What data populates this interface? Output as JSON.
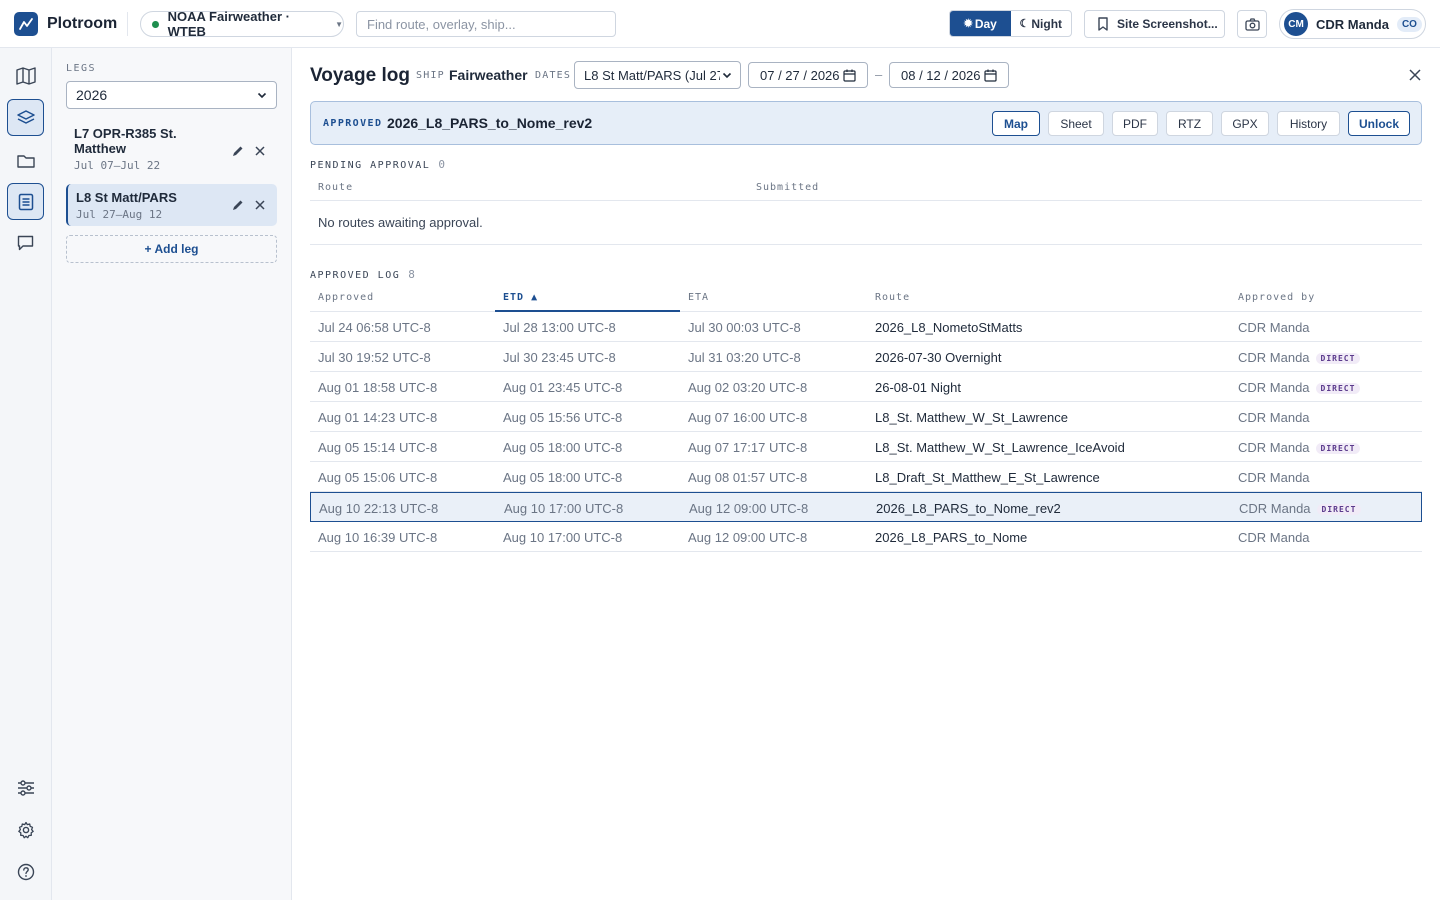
{
  "app": {
    "name": "Plotroom"
  },
  "topbar": {
    "ship_selector": "NOAA Fairweather · WTEB",
    "search_placeholder": "Find route, overlay, ship...",
    "day_label": "Day",
    "night_label": "Night",
    "mode_active": "Day",
    "site_screenshot_label": "Site Screenshot...",
    "user": {
      "initials": "CM",
      "name": "CDR Manda",
      "role": "CO"
    }
  },
  "rail": {
    "icons": [
      "map-icon",
      "layers-icon",
      "folder-icon",
      "document-icon",
      "chat-icon",
      "sliders-icon",
      "gear-icon",
      "help-icon"
    ],
    "active": [
      "layers-icon",
      "document-icon"
    ]
  },
  "legs_panel": {
    "title": "LEGS",
    "year": "2026",
    "items": [
      {
        "name": "L7 OPR-R385 St. Matthew",
        "dates": "Jul 07–Jul 22",
        "selected": false
      },
      {
        "name": "L8 St Matt/PARS",
        "dates": "Jul 27–Aug 12",
        "selected": true
      }
    ],
    "add_label": "+ Add leg"
  },
  "main": {
    "title": "Voyage log",
    "ship_kw": "SHIP",
    "ship": "Fairweather",
    "dates_kw": "DATES",
    "leg_select": "L8 St Matt/PARS (Jul 27",
    "date_from": "07 / 27 / 2026",
    "date_to": "08 / 12 / 2026",
    "date_sep": "–",
    "banner": {
      "kw": "APPROVED",
      "route": "2026_L8_PARS_to_Nome_rev2",
      "buttons": [
        "Map",
        "Sheet",
        "PDF",
        "RTZ",
        "GPX",
        "History",
        "Unlock"
      ],
      "accent": "#1d4f91"
    },
    "pending": {
      "title": "PENDING APPROVAL",
      "count": "0",
      "columns": [
        "Route",
        "Submitted"
      ],
      "empty": "No routes awaiting approval."
    },
    "approved": {
      "title": "APPROVED LOG",
      "count": "8",
      "columns": [
        "Approved",
        "ETD ▲",
        "ETA",
        "Route",
        "Approved by"
      ],
      "direct_label": "DIRECT",
      "rows": [
        {
          "approved": "Jul 24 06:58 UTC-8",
          "etd": "Jul 28 13:00 UTC-8",
          "eta": "Jul 30 00:03 UTC-8",
          "route": "2026_L8_NometoStMatts",
          "by": "CDR Manda",
          "direct": false,
          "selected": false
        },
        {
          "approved": "Jul 30 19:52 UTC-8",
          "etd": "Jul 30 23:45 UTC-8",
          "eta": "Jul 31 03:20 UTC-8",
          "route": "2026-07-30 Overnight",
          "by": "CDR Manda",
          "direct": true,
          "selected": false
        },
        {
          "approved": "Aug 01 18:58 UTC-8",
          "etd": "Aug 01 23:45 UTC-8",
          "eta": "Aug 02 03:20 UTC-8",
          "route": "26-08-01 Night",
          "by": "CDR Manda",
          "direct": true,
          "selected": false
        },
        {
          "approved": "Aug 01 14:23 UTC-8",
          "etd": "Aug 05 15:56 UTC-8",
          "eta": "Aug 07 16:00 UTC-8",
          "route": "L8_St. Matthew_W_St_Lawrence",
          "by": "CDR Manda",
          "direct": false,
          "selected": false
        },
        {
          "approved": "Aug 05 15:14 UTC-8",
          "etd": "Aug 05 18:00 UTC-8",
          "eta": "Aug 07 17:17 UTC-8",
          "route": "L8_St. Matthew_W_St_Lawrence_IceAvoid",
          "by": "CDR Manda",
          "direct": true,
          "selected": false
        },
        {
          "approved": "Aug 05 15:06 UTC-8",
          "etd": "Aug 05 18:00 UTC-8",
          "eta": "Aug 08 01:57 UTC-8",
          "route": "L8_Draft_St_Matthew_E_St_Lawrence",
          "by": "CDR Manda",
          "direct": false,
          "selected": false
        },
        {
          "approved": "Aug 10 22:13 UTC-8",
          "etd": "Aug 10 17:00 UTC-8",
          "eta": "Aug 12 09:00 UTC-8",
          "route": "2026_L8_PARS_to_Nome_rev2",
          "by": "CDR Manda",
          "direct": true,
          "selected": true
        },
        {
          "approved": "Aug 10 16:39 UTC-8",
          "etd": "Aug 10 17:00 UTC-8",
          "eta": "Aug 12 09:00 UTC-8",
          "route": "2026_L8_PARS_to_Nome",
          "by": "CDR Manda",
          "direct": false,
          "selected": false
        }
      ]
    }
  }
}
